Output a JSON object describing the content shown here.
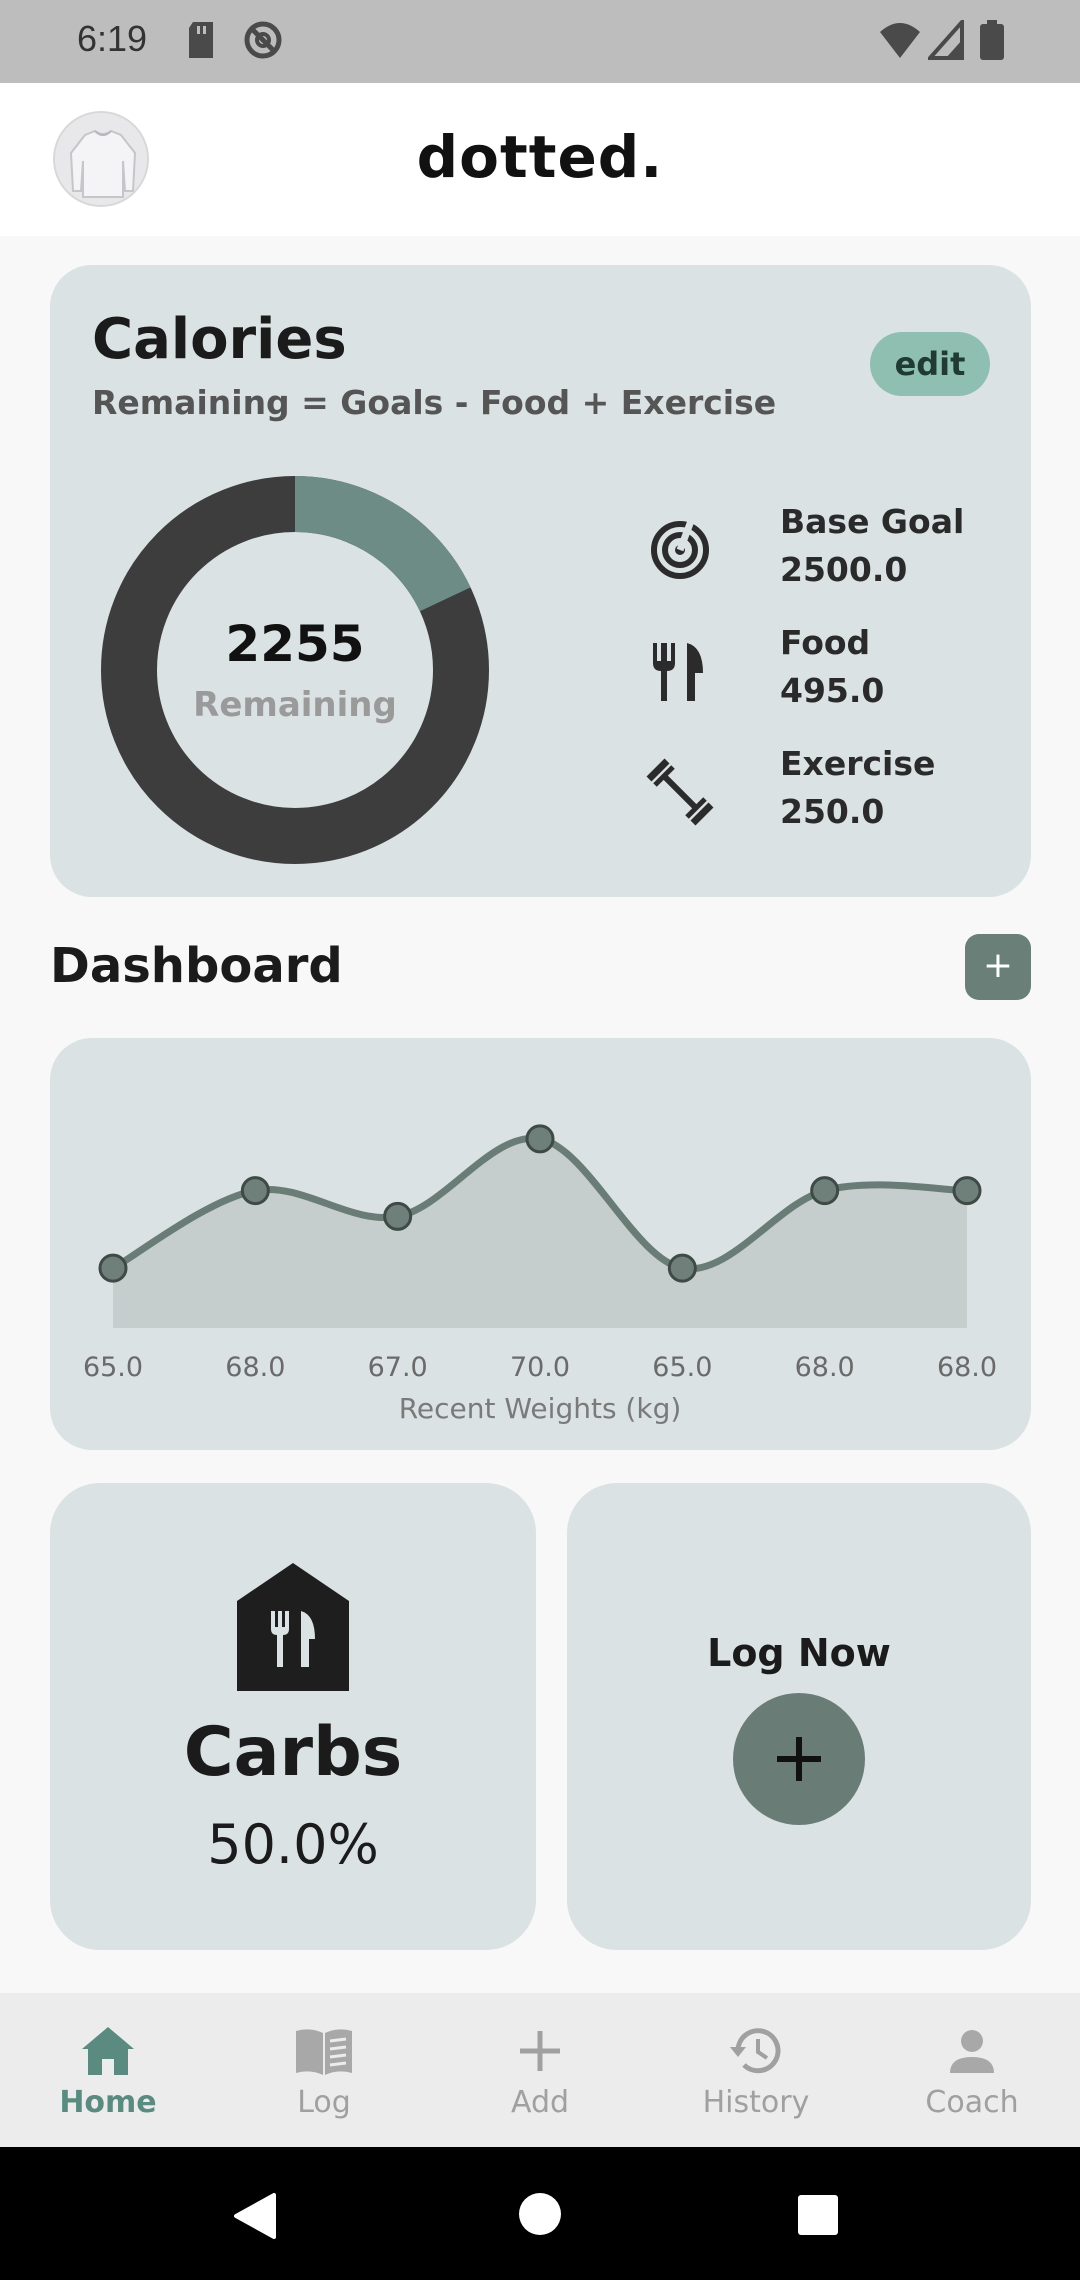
{
  "status_bar": {
    "time": "6:19"
  },
  "header": {
    "title": "dotted."
  },
  "calories": {
    "title": "Calories",
    "formula": "Remaining = Goals - Food + Exercise",
    "edit_label": "edit",
    "remaining_value": "2255",
    "remaining_label": "Remaining",
    "consumed_fraction": 0.18,
    "ring_colors": {
      "remaining": "#3d3d3d",
      "consumed": "#6d8c86"
    },
    "stats": [
      {
        "icon": "target-icon",
        "label": "Base Goal",
        "value": "2500.0"
      },
      {
        "icon": "fork-knife-icon",
        "label": "Food",
        "value": "495.0"
      },
      {
        "icon": "dumbbell-icon",
        "label": "Exercise",
        "value": "250.0"
      }
    ]
  },
  "dashboard": {
    "title": "Dashboard",
    "add_label": "+"
  },
  "chart_data": {
    "type": "area",
    "x_label": "Recent Weights (kg)",
    "categories": [
      "65.0",
      "68.0",
      "67.0",
      "70.0",
      "65.0",
      "68.0",
      "68.0"
    ],
    "values": [
      65.0,
      68.0,
      67.0,
      70.0,
      65.0,
      68.0,
      68.0
    ],
    "ylim": [
      64,
      71
    ],
    "grid": false,
    "line_color": "#6a7c76",
    "fill_color": "#c6cecd",
    "point_color": "#6f7f79"
  },
  "carbs": {
    "label": "Carbs",
    "value": "50.0%"
  },
  "log_now": {
    "label": "Log Now"
  },
  "nav": {
    "items": [
      {
        "label": "Home",
        "icon": "home-icon",
        "active": true
      },
      {
        "label": "Log",
        "icon": "book-icon",
        "active": false
      },
      {
        "label": "Add",
        "icon": "plus-icon",
        "active": false
      },
      {
        "label": "History",
        "icon": "history-icon",
        "active": false
      },
      {
        "label": "Coach",
        "icon": "person-icon",
        "active": false
      }
    ]
  }
}
